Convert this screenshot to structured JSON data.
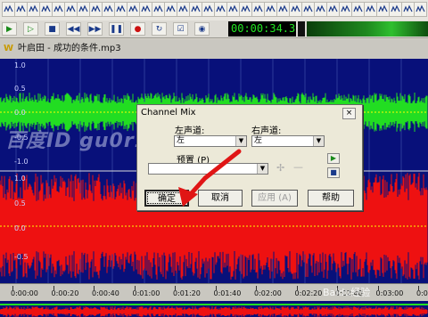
{
  "toolbar_top": {
    "icons": [
      "text-x-icon",
      "marker-icon",
      "cut-icon",
      "move-icon",
      "sort-up-icon",
      "sort-down-icon",
      "sparkle-icon",
      "waveform-icon",
      "cross-icon",
      "wave-select-icon",
      "dotted-icon",
      "zigzag-icon",
      "music-icon",
      "mix-icon",
      "keyboard-icon",
      "back-arrow-icon",
      "fade-in-icon",
      "fade-out-icon",
      "channel-mix-icon",
      "speaker-icon",
      "wave-flip-icon",
      "eye-icon",
      "sparkle-icon-2",
      "stretch-icon",
      "butterfly-icon",
      "wave-grid-icon",
      "arrow-down-icon",
      "circle-icon",
      "circle-dot-icon",
      "key-icon",
      "person-icon",
      "dot-icon",
      "sound-icon",
      "more-icon"
    ]
  },
  "toolbar_transport": {
    "icons": [
      "play-icon",
      "play-selection-icon",
      "stop-icon",
      "rewind-icon",
      "fast-forward-icon",
      "pause-icon",
      "record-icon",
      "loop-icon",
      "checkbox-icon",
      "record-mode-icon"
    ],
    "time": "00:00:34.3"
  },
  "document": {
    "logo": "W",
    "title": "叶启田 - 成功的条件.mp3"
  },
  "waveform": {
    "axis_labels_top": [
      "1.0",
      "0.5",
      "0.0",
      "-0.5",
      "-1.0"
    ],
    "axis_labels_bottom": [
      "1.0",
      "0.5",
      "0.0",
      "-0.5"
    ],
    "colors": {
      "background": "#08107a",
      "left_channel": "#22dd22",
      "right_channel": "#ee1111",
      "center": "#ffff00",
      "grid": "#2b3a9a"
    }
  },
  "ruler": {
    "labels": [
      "0:00:00",
      "0:00:20",
      "0:00:40",
      "0:01:00",
      "0:01:20",
      "0:01:40",
      "0:02:00",
      "0:02:20",
      "0:02:40",
      "0:03:00",
      "0:03:20"
    ]
  },
  "dialog": {
    "title": "Channel Mix",
    "close": "×",
    "left_label": "左声道:",
    "left_value": "左",
    "right_label": "右声道:",
    "right_value": "左",
    "preset_label": "预置 (P)",
    "preset_value": "",
    "ok": "确定",
    "cancel": "取消",
    "apply": "应用 (A)",
    "help": "帮助"
  },
  "watermark": "百度ID gu0r1",
  "corner_watermark": "Baidu经验"
}
